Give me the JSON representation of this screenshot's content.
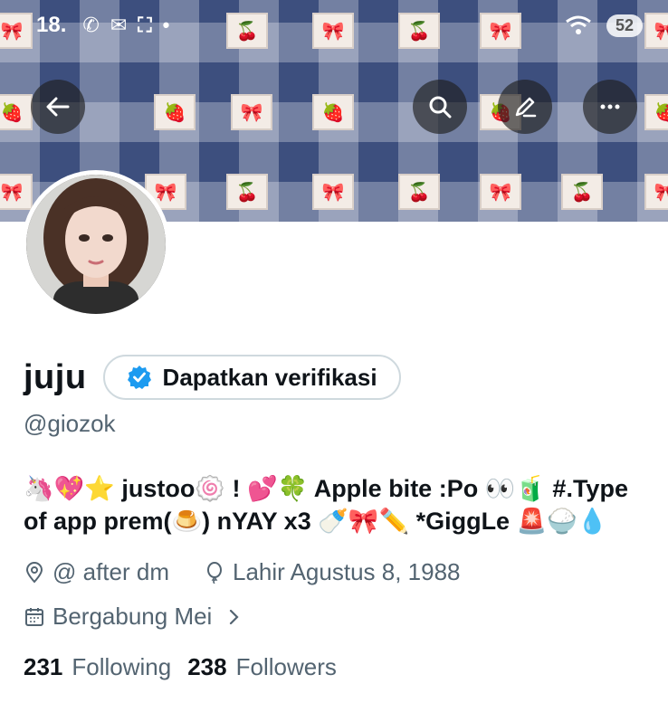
{
  "status_bar": {
    "time": "18.",
    "icons": [
      "whatsapp-icon",
      "messenger-icon",
      "screenshot-icon",
      "dot-icon"
    ],
    "right_icons": [
      "wifi-icon"
    ],
    "battery": "52"
  },
  "nav": {
    "back_icon": "arrow-left-icon",
    "search_icon": "search-icon",
    "edit_icon": "pencil-icon",
    "more_icon": "more-horizontal-icon"
  },
  "profile": {
    "name": "juju",
    "verify_button_label": "Dapatkan verifikasi",
    "handle": "@giozok",
    "bio": "🦄💖⭐ justoo🍥 ! 💕🍀 Apple bite :Po 👀🧃 #.Type of app prem(🍮) nYAY x3 🍼🎀✏️ *GiggLe 🚨🍚💧",
    "location": "@ after dm",
    "birthday": "Lahir Agustus 8, 1988",
    "joined": "Bergabung Mei",
    "following_count": "231",
    "following_label": "Following",
    "followers_count": "238",
    "followers_label": "Followers"
  },
  "colors": {
    "verified_blue": "#1d9bf0",
    "secondary_text": "#536471",
    "primary_text": "#0f1419",
    "banner_blue": "#3d4f7e"
  }
}
